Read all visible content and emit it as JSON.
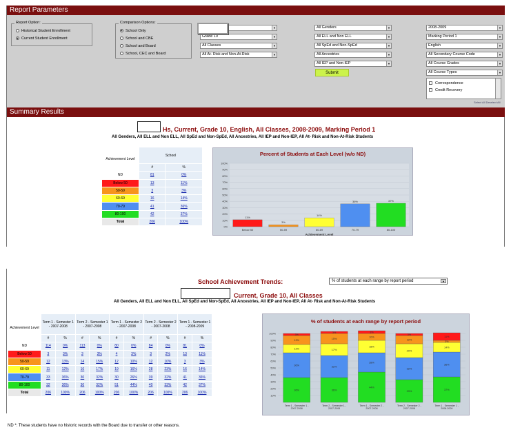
{
  "report_parameters": {
    "title": "Report Parameters"
  },
  "report_option": {
    "legend": "Report Option:",
    "options": [
      "Historical Student Enrollment",
      "Current Student Enrollment"
    ],
    "selected": 1
  },
  "comparison_options": {
    "legend": "Comparison Options:",
    "options": [
      "School Only",
      "School and CBE",
      "School and Board",
      "School, CEC and Board"
    ],
    "selected": 0
  },
  "filters": {
    "col1": [
      "",
      "Grade 10",
      "All Classes",
      "All At- Risk and Non-At-Risk"
    ],
    "col2": [
      "All Genders",
      "All ELL and Non ELL",
      "All SpEd and Non-SpEd",
      "All Ancestries",
      "All IEP and Non-IEP"
    ],
    "col3": [
      "2008-2009",
      "Marking Period 1",
      "English",
      "All Secondary Course Code",
      "All Course Grades",
      "All Course Types"
    ]
  },
  "submit_label": "Submit",
  "listbox_items": [
    "Correspondence",
    "Credit Recovery"
  ],
  "tiny_links": "Select All  Deselect All",
  "summary_results": {
    "title": "Summary Results"
  },
  "summary": {
    "title": "Hs,  Current, Grade 10, English, All Classes, 2008-2009, Marking Period 1",
    "subtitle": "All Genders, All ELL and Non ELL, All SpEd and Non-SpEd, All Ancestries, All IEP and Non-IEP, All At- Risk and Non-At-Risk Students",
    "table": {
      "col_header": "School",
      "row_header": "Achievement Level",
      "sub_headers": [
        "#",
        "%"
      ],
      "rows": [
        {
          "label": "ND",
          "n": "81",
          "p": "0%",
          "color": "#ffffff"
        },
        {
          "label": "Below 50",
          "n": "13",
          "p": "11%",
          "color": "#ff1a1a"
        },
        {
          "label": "50-59",
          "n": "3",
          "p": "3%",
          "color": "#f7941d"
        },
        {
          "label": "60-69",
          "n": "16",
          "p": "14%",
          "color": "#ffff33"
        },
        {
          "label": "70-79",
          "n": "41",
          "p": "36%",
          "color": "#4f8ff0"
        },
        {
          "label": "80-100",
          "n": "42",
          "p": "37%",
          "color": "#22dd22"
        },
        {
          "label": "Total",
          "n": "206",
          "p": "100%",
          "color": "#e8e8e8"
        }
      ]
    }
  },
  "chart_data": [
    {
      "type": "bar",
      "title": "Percent of Students at Each Level (w/o ND)",
      "categories": [
        "Below 50",
        "50-59",
        "60-69",
        "70-79",
        "80-100"
      ],
      "values": [
        11,
        3,
        14,
        36,
        37
      ],
      "data_labels": [
        "11%",
        "3%",
        "14%",
        "36%",
        "37%"
      ],
      "ylim": [
        0,
        100
      ],
      "yticks": [
        "100%",
        "90%",
        "80%",
        "70%",
        "60%",
        "50%",
        "40%",
        "30%",
        "20%",
        "10%",
        "0%"
      ],
      "xlabel": "Achievement Level",
      "colors": [
        "#ff1a1a",
        "#f7941d",
        "#ffff33",
        "#4f8ff0",
        "#22dd22"
      ]
    },
    {
      "type": "bar",
      "stacked": true,
      "title": "% of students at each range by report period",
      "categories": [
        "Term 1 - Semester 1 - 2007-2008",
        "Term 2 - Semester 1 - 2007-2008",
        "Term 1 - Semester 2 - 2007-2008",
        "Term 2 - Semester 2 - 2007-2008",
        "Term 1 - Semester 1 - 2008-2009"
      ],
      "series": [
        {
          "name": "80-100",
          "color": "#22dd22",
          "values": [
            36,
            36,
            44,
            33,
            37
          ],
          "labels": [
            "36%",
            "36%",
            "44%",
            "33%",
            "37%"
          ]
        },
        {
          "name": "70-79",
          "color": "#4f8ff0",
          "values": [
            36,
            32,
            28,
            32,
            36
          ],
          "labels": [
            "36%",
            "32%",
            "28%",
            "32%",
            "36%"
          ]
        },
        {
          "name": "60-69",
          "color": "#ffff33",
          "values": [
            12,
            17,
            18,
            20,
            14
          ],
          "labels": [
            "12%",
            "17%",
            "18%",
            "20%",
            "14%"
          ]
        },
        {
          "name": "50-59",
          "color": "#f7941d",
          "values": [
            13,
            15,
            10,
            12,
            3
          ],
          "labels": [
            "13%",
            "15%",
            "10%",
            "12%",
            "3%"
          ]
        },
        {
          "name": "Below 50",
          "color": "#ff1a1a",
          "values": [
            3,
            3,
            4,
            3,
            11
          ],
          "labels": [
            "3%",
            "3%",
            "3%",
            "3%",
            "11%"
          ]
        }
      ],
      "ylim": [
        0,
        100
      ],
      "yticks": [
        "100%",
        "90%",
        "80%",
        "70%",
        "60%",
        "50%",
        "40%",
        "30%",
        "20%",
        "10%"
      ]
    }
  ],
  "trends": {
    "title": "School Achievement Trends:",
    "dropdown": "% of students at each range by report period",
    "heading": "Current,  Grade 10, All Classes",
    "subtitle": "All Genders, All ELL and Non ELL, All SpEd and Non-SpEd, All Ancestries, All IEP and Non-IEP, All At- Risk and Non-At-Risk Students",
    "row_header": "Achievement Level",
    "periods": [
      "Term 1 - Semester 1 - 2007-2008",
      "Term 2 - Semester 1 - 2007-2008",
      "Term 1 - Semester 2 - 2007-2008",
      "Term 2 - Semester 2 - 2007-2008",
      "Term 1 - Semester 1 - 2008-2009"
    ],
    "sub_headers": [
      "#",
      "%"
    ],
    "rows": [
      {
        "label": "ND",
        "color": "#ffffff",
        "vals": [
          "114",
          "0%",
          "113",
          "0%",
          "80",
          "0%",
          "84",
          "0%",
          "81",
          "0%"
        ]
      },
      {
        "label": "Below 50",
        "color": "#ff1a1a",
        "vals": [
          "3",
          "3%",
          "3",
          "3%",
          "4",
          "3%",
          "3",
          "2%",
          "13",
          "11%"
        ]
      },
      {
        "label": "50-59",
        "color": "#f7941d",
        "vals": [
          "12",
          "13%",
          "14",
          "15%",
          "12",
          "10%",
          "12",
          "10%",
          "3",
          "3%"
        ]
      },
      {
        "label": "60-69",
        "color": "#ffff33",
        "vals": [
          "11",
          "12%",
          "16",
          "17%",
          "19",
          "16%",
          "28",
          "23%",
          "16",
          "14%"
        ]
      },
      {
        "label": "70-79",
        "color": "#4f8ff0",
        "vals": [
          "33",
          "36%",
          "30",
          "32%",
          "30",
          "26%",
          "39",
          "32%",
          "41",
          "36%"
        ]
      },
      {
        "label": "80-100",
        "color": "#22dd22",
        "vals": [
          "32",
          "36%",
          "30",
          "32%",
          "51",
          "44%",
          "40",
          "33%",
          "42",
          "37%"
        ]
      },
      {
        "label": "Total",
        "color": "#e8e8e8",
        "vals": [
          "206",
          "100%",
          "206",
          "100%",
          "206",
          "100%",
          "206",
          "100%",
          "206",
          "100%"
        ]
      }
    ]
  },
  "footnote": "ND *:  These students have no historic records with the Board due to transfer or other reasons."
}
